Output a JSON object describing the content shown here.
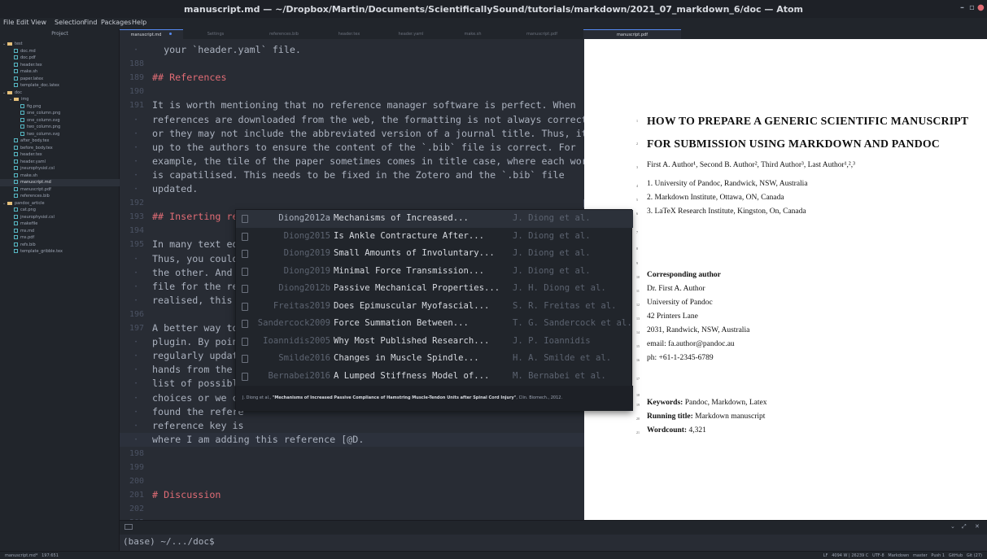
{
  "window": {
    "title": "manuscript.md — ~/Dropbox/Martin/Documents/ScientificallySound/tutorials/markdown/2021_07_markdown_6/doc — Atom"
  },
  "menu": [
    "File",
    "Edit",
    "View",
    "Selection",
    "Find",
    "Packages",
    "Help"
  ],
  "sidebar": {
    "header": "Project",
    "items": [
      {
        "label": "test",
        "type": "folder",
        "depth": 0
      },
      {
        "label": "doc.md",
        "type": "file",
        "depth": 1
      },
      {
        "label": "doc.pdf",
        "type": "file",
        "depth": 1
      },
      {
        "label": "header.tex",
        "type": "file",
        "depth": 1
      },
      {
        "label": "make.sh",
        "type": "file",
        "depth": 1
      },
      {
        "label": "paper.latex",
        "type": "file",
        "depth": 1
      },
      {
        "label": "template_doc.latex",
        "type": "file",
        "depth": 1
      },
      {
        "label": "doc",
        "type": "folder",
        "depth": 0
      },
      {
        "label": "img",
        "type": "folder",
        "depth": 1
      },
      {
        "label": "fig.png",
        "type": "file",
        "depth": 2
      },
      {
        "label": "one_column.png",
        "type": "file",
        "depth": 2
      },
      {
        "label": "one_column.svg",
        "type": "file",
        "depth": 2
      },
      {
        "label": "two_column.png",
        "type": "file",
        "depth": 2
      },
      {
        "label": "two_column.svg",
        "type": "file",
        "depth": 2
      },
      {
        "label": "after_body.tex",
        "type": "file",
        "depth": 1
      },
      {
        "label": "before_body.tex",
        "type": "file",
        "depth": 1
      },
      {
        "label": "header.tex",
        "type": "file",
        "depth": 1
      },
      {
        "label": "header.yaml",
        "type": "file",
        "depth": 1
      },
      {
        "label": "jneurophysiol.csl",
        "type": "file",
        "depth": 1
      },
      {
        "label": "make.sh",
        "type": "file",
        "depth": 1
      },
      {
        "label": "manuscript.md",
        "type": "file",
        "depth": 1,
        "selected": true
      },
      {
        "label": "manuscript.pdf",
        "type": "file",
        "depth": 1
      },
      {
        "label": "references.bib",
        "type": "file",
        "depth": 1
      },
      {
        "label": "pandoc_article",
        "type": "folder",
        "depth": 0
      },
      {
        "label": "cat.png",
        "type": "file",
        "depth": 1
      },
      {
        "label": "jneurophysiol.csl",
        "type": "file",
        "depth": 1
      },
      {
        "label": "makefile",
        "type": "file",
        "depth": 1
      },
      {
        "label": "ms.md",
        "type": "file",
        "depth": 1
      },
      {
        "label": "ms.pdf",
        "type": "file",
        "depth": 1
      },
      {
        "label": "refs.bib",
        "type": "file",
        "depth": 1
      },
      {
        "label": "template_gribble.tex",
        "type": "file",
        "depth": 1
      }
    ]
  },
  "tabs": [
    {
      "label": "manuscript.md",
      "active": true,
      "modified": true
    },
    {
      "label": "Settings",
      "active": false
    },
    {
      "label": "references.bib",
      "active": false
    },
    {
      "label": "header.tex",
      "active": false
    },
    {
      "label": "header.yaml",
      "active": false
    },
    {
      "label": "make.sh",
      "active": false
    },
    {
      "label": "manuscript.pdf",
      "active": false
    },
    {
      "label": "manuscript.pdf",
      "active": true
    }
  ],
  "editor": {
    "lines": [
      {
        "num": "",
        "text": "  your `header.yaml` file.",
        "kind": "text"
      },
      {
        "num": "188",
        "text": "",
        "kind": "text"
      },
      {
        "num": "189",
        "text": "## References",
        "kind": "heading"
      },
      {
        "num": "190",
        "text": "",
        "kind": "text"
      },
      {
        "num": "191",
        "text": "It is worth mentioning that no reference manager software is perfect. When",
        "kind": "text"
      },
      {
        "num": "",
        "text": "references are downloaded from the web, the formatting is not always correct,",
        "kind": "text"
      },
      {
        "num": "",
        "text": "or they may not include the abbreviated version of a journal title. Thus, it is",
        "kind": "text"
      },
      {
        "num": "",
        "text": "up to the authors to ensure the content of the `.bib` file is correct. For",
        "kind": "text"
      },
      {
        "num": "",
        "text": "example, the tile of the paper sometimes comes in title case, where each word",
        "kind": "text"
      },
      {
        "num": "",
        "text": "is capatilised. This needs to be fixed in the Zotero and the `.bib` file",
        "kind": "text"
      },
      {
        "num": "",
        "text": "updated.",
        "kind": "text"
      },
      {
        "num": "192",
        "text": "",
        "kind": "text"
      },
      {
        "num": "193",
        "text": "## Inserting references",
        "kind": "heading"
      },
      {
        "num": "194",
        "text": "",
        "kind": "text"
      },
      {
        "num": "195",
        "text": "In many text ed",
        "kind": "text"
      },
      {
        "num": "",
        "text": "Thus, you could",
        "kind": "text"
      },
      {
        "num": "",
        "text": "the other. And w",
        "kind": "text"
      },
      {
        "num": "",
        "text": "file for the ref",
        "kind": "text"
      },
      {
        "num": "",
        "text": "realised, this i",
        "kind": "text"
      },
      {
        "num": "196",
        "text": "",
        "kind": "text"
      },
      {
        "num": "197",
        "text": "A better way to",
        "kind": "text"
      },
      {
        "num": "",
        "text": "plugin. By point",
        "kind": "text"
      },
      {
        "num": "",
        "text": "regularly update",
        "kind": "text"
      },
      {
        "num": "",
        "text": "hands from the h",
        "kind": "text"
      },
      {
        "num": "",
        "text": "list of possible",
        "kind": "text"
      },
      {
        "num": "",
        "text": "choices or we ca",
        "kind": "text"
      },
      {
        "num": "",
        "text": "found the refere",
        "kind": "text"
      },
      {
        "num": "",
        "text": "reference key is",
        "kind": "text"
      },
      {
        "num": "",
        "text": "where I am adding this reference [@D.",
        "kind": "cursor"
      },
      {
        "num": "198",
        "text": "",
        "kind": "text"
      },
      {
        "num": "199",
        "text": "",
        "kind": "text"
      },
      {
        "num": "200",
        "text": "",
        "kind": "text"
      },
      {
        "num": "201",
        "text": "# Discussion",
        "kind": "heading"
      },
      {
        "num": "202",
        "text": "",
        "kind": "text"
      },
      {
        "num": "203",
        "text": "",
        "kind": "text"
      },
      {
        "num": "204",
        "text": "",
        "kind": "text"
      }
    ]
  },
  "autocomplete": {
    "rows": [
      {
        "key": "Diong2012a",
        "title": "Mechanisms of Increased...",
        "authors": "J. Diong et al.",
        "selected": true
      },
      {
        "key": "Diong2015",
        "title": "Is Ankle Contracture After...",
        "authors": "J. Diong et al."
      },
      {
        "key": "Diong2019",
        "title": "Small Amounts of Involuntary...",
        "authors": "J. Diong et al."
      },
      {
        "key": "Diong2019",
        "title": "Minimal Force Transmission...",
        "authors": "J. Diong et al."
      },
      {
        "key": "Diong2012b",
        "title": "Passive Mechanical Properties...",
        "authors": "J. H. Diong et al."
      },
      {
        "key": "Freitas2019",
        "title": "Does Epimuscular Myofascial...",
        "authors": "S. R. Freitas et al."
      },
      {
        "key": "Sandercock2009",
        "title": "Force Summation Between...",
        "authors": "T. G. Sandercock et al."
      },
      {
        "key": "Ioannidis2005",
        "title": "Why Most Published Research...",
        "authors": "J. P. Ioannidis"
      },
      {
        "key": "Smilde2016",
        "title": "Changes in Muscle Spindle...",
        "authors": "H. A. Smilde et al."
      },
      {
        "key": "Bernabei2016",
        "title": "A Lumped Stiffness Model of...",
        "authors": "M. Bernabei et al."
      }
    ],
    "description_authors": "J. Diong et al., ",
    "description_title": "\"Mechanisms of Increased Passive Compliance of Hamstring Muscle-Tendon Units after Spinal Cord Injury\"",
    "description_journal": ", Clin. Biomech., 2012."
  },
  "pdf": {
    "title_line1": "HOW TO PREPARE A GENERIC SCIENTIFIC MANUSCRIPT",
    "title_line2": "FOR SUBMISSION USING MARKDOWN AND PANDOC",
    "authors": "First A. Author¹, Second B. Author², Third Author³, Last Author¹,²,³",
    "affiliations": [
      "1. University of Pandoc, Randwick, NSW, Australia",
      "2. Markdown Institute, Ottawa, ON, Canada",
      "3. LaTeX Research Institute, Kingston, On, Canada"
    ],
    "corresponding_label": "Corresponding author",
    "corresponding": [
      "Dr. First A. Author",
      "University of Pandoc",
      "42 Printers Lane",
      "2031, Randwick, NSW, Australia",
      "email: fa.author@pandoc.au",
      "ph: +61-1-2345-6789"
    ],
    "keywords_label": "Keywords:",
    "keywords": "Pandoc, Markdown, Latex",
    "running_label": "Running title:",
    "running": "Markdown manuscript",
    "wordcount_label": "Wordcount:",
    "wordcount": "4,321",
    "line_numbers": [
      "1",
      "2",
      "3",
      "4",
      "5",
      "6",
      "7",
      "8",
      "9",
      "10",
      "11",
      "12",
      "13",
      "14",
      "15",
      "16",
      "17",
      "18",
      "19",
      "20",
      "21"
    ]
  },
  "terminal": {
    "prompt": "(base) ~/.../doc$"
  },
  "status": {
    "left": "manuscript.md*   197:651",
    "right": "LF   4094 W | 26239 C   UTF-8   Markdown   master   Push 1   GitHub   Git (27)"
  }
}
